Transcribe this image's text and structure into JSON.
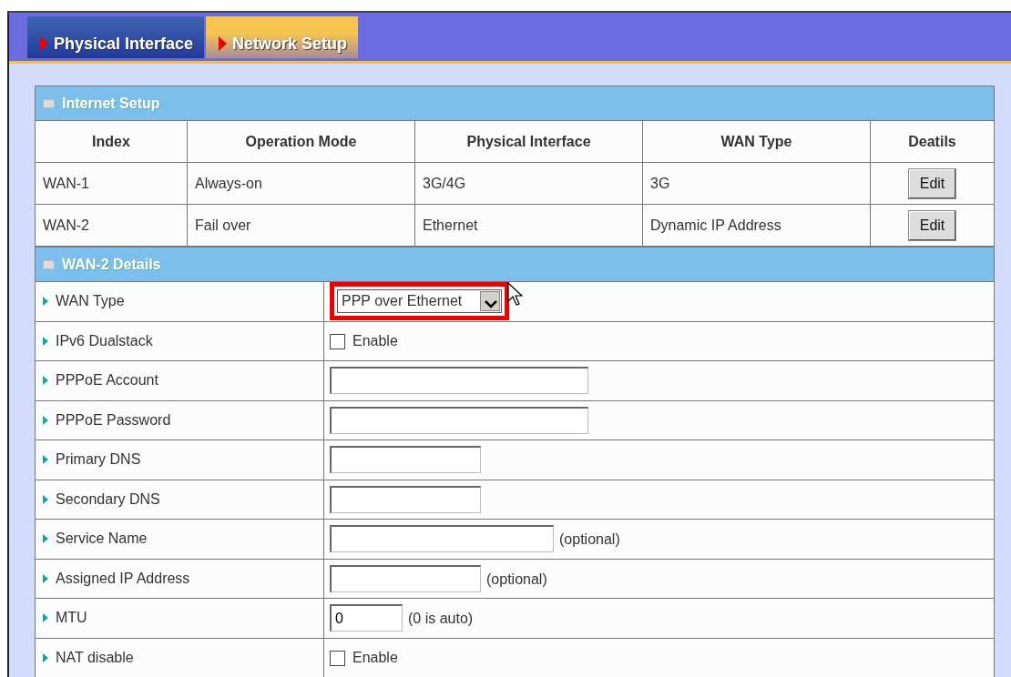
{
  "tabs": [
    {
      "label": "Physical Interface",
      "selected": false
    },
    {
      "label": "Network Setup",
      "selected": true
    }
  ],
  "internet_setup": {
    "title": "Internet Setup",
    "columns": [
      "Index",
      "Operation Mode",
      "Physical Interface",
      "WAN Type",
      "Deatils"
    ],
    "rows": [
      {
        "index": "WAN-1",
        "mode": "Always-on",
        "interface": "3G/4G",
        "wan_type": "3G",
        "action": "Edit"
      },
      {
        "index": "WAN-2",
        "mode": "Fail over",
        "interface": "Ethernet",
        "wan_type": "Dynamic IP Address",
        "action": "Edit"
      }
    ]
  },
  "details": {
    "title": "WAN-2 Details",
    "rows": [
      {
        "kind": "select",
        "label": "WAN Type",
        "value": "PPP over Ethernet",
        "highlighted": true
      },
      {
        "kind": "checkbox",
        "label": "IPv6 Dualstack",
        "text": "Enable",
        "checked": false
      },
      {
        "kind": "text",
        "label": "PPPoE Account"
      },
      {
        "kind": "text",
        "label": "PPPoE Password"
      },
      {
        "kind": "text",
        "label": "Primary DNS"
      },
      {
        "kind": "text",
        "label": "Secondary DNS"
      },
      {
        "kind": "text",
        "label": "Service Name",
        "note": "(optional)"
      },
      {
        "kind": "text",
        "label": "Assigned IP Address",
        "note": "(optional)"
      },
      {
        "kind": "text",
        "label": "MTU",
        "value": "0",
        "note": "(0 is auto)"
      },
      {
        "kind": "checkbox",
        "label": "NAT disable",
        "text": "Enable",
        "checked": false
      }
    ]
  }
}
